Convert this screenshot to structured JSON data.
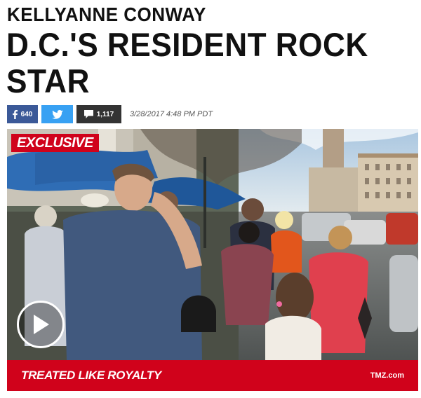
{
  "article": {
    "kicker": "KELLYANNE CONWAY",
    "headline_lines": [
      "D.C.'S RESIDENT ROCK",
      "STAR"
    ],
    "timestamp": "3/28/2017 4:48 PM PDT"
  },
  "share": {
    "facebook": {
      "icon": "facebook-icon",
      "count": "640"
    },
    "twitter": {
      "icon": "twitter-icon"
    },
    "comments": {
      "icon": "comment-icon",
      "count": "1,117"
    }
  },
  "video": {
    "badge": "EXCLUSIVE",
    "caption": "TREATED LIKE ROYALTY",
    "source": "TMZ.com",
    "play_icon": "play-icon"
  },
  "colors": {
    "brand_red": "#d0021b",
    "facebook_blue": "#3b5998",
    "twitter_blue": "#38a1f3",
    "comment_dark": "#333333"
  }
}
